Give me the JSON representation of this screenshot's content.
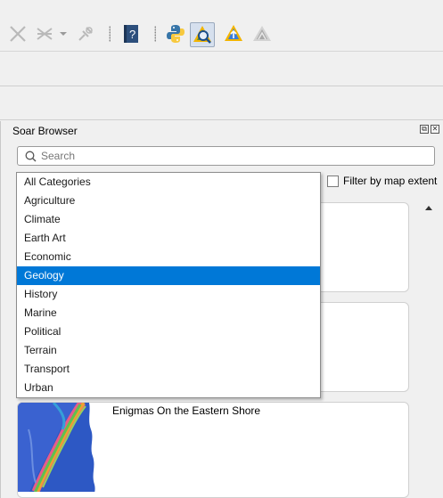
{
  "toolbar": {
    "icons": [
      "close-x-icon",
      "merge-x-icon",
      "dropdown-arrow-icon",
      "plugin-tool-icon",
      "help-book-icon",
      "python-icon",
      "soar-browser-icon",
      "soar-upload-icon",
      "soar-disabled-icon"
    ],
    "active_icon": "soar-browser-icon"
  },
  "panel": {
    "title": "Soar Browser",
    "float_button": "⧉",
    "close_button": "✕"
  },
  "search": {
    "placeholder": "Search",
    "value": ""
  },
  "filter": {
    "label": "Filter by map extent",
    "checked": false
  },
  "category_dropdown": {
    "items": [
      "All Categories",
      "Agriculture",
      "Climate",
      "Earth Art",
      "Economic",
      "Geology",
      "History",
      "Marine",
      "Political",
      "Terrain",
      "Transport",
      "Urban"
    ],
    "selected": "Geology",
    "selected_color": "#0078d7"
  },
  "results": [
    {
      "title": ""
    },
    {
      "title": ""
    },
    {
      "title": "Enigmas On the Eastern Shore"
    }
  ]
}
